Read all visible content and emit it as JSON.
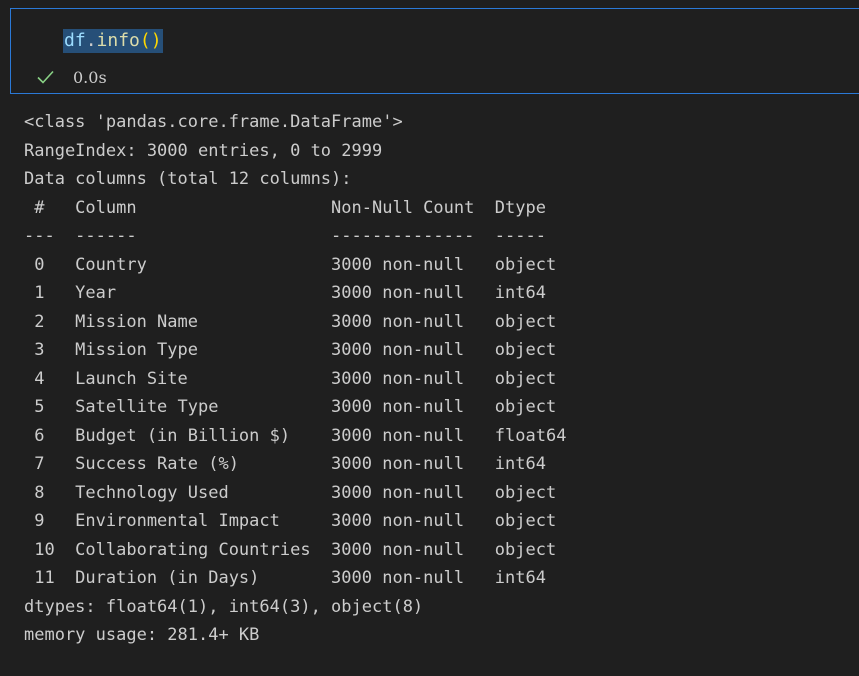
{
  "cell": {
    "code": {
      "object": "df",
      "dot": ".",
      "method": "info",
      "parens": "()"
    },
    "status": {
      "icon": "check-icon",
      "exec_time": "0.0s"
    }
  },
  "output": {
    "lines": [
      "<class 'pandas.core.frame.DataFrame'>",
      "RangeIndex: 3000 entries, 0 to 2999",
      "Data columns (total 12 columns):",
      " #   Column                   Non-Null Count  Dtype  ",
      "---  ------                   --------------  -----  ",
      " 0   Country                  3000 non-null   object ",
      " 1   Year                     3000 non-null   int64  ",
      " 2   Mission Name             3000 non-null   object ",
      " 3   Mission Type             3000 non-null   object ",
      " 4   Launch Site              3000 non-null   object ",
      " 5   Satellite Type           3000 non-null   object ",
      " 6   Budget (in Billion $)    3000 non-null   float64",
      " 7   Success Rate (%)         3000 non-null   int64  ",
      " 8   Technology Used          3000 non-null   object ",
      " 9   Environmental Impact     3000 non-null   object ",
      " 10  Collaborating Countries  3000 non-null   object ",
      " 11  Duration (in Days)       3000 non-null   int64  ",
      "dtypes: float64(1), int64(3), object(8)",
      "memory usage: 281.4+ KB"
    ]
  },
  "colors": {
    "background": "#1f1f1f",
    "cell_border": "#2b79d6",
    "selection": "#264f78",
    "success": "#89d185",
    "text": "#cccccc"
  }
}
